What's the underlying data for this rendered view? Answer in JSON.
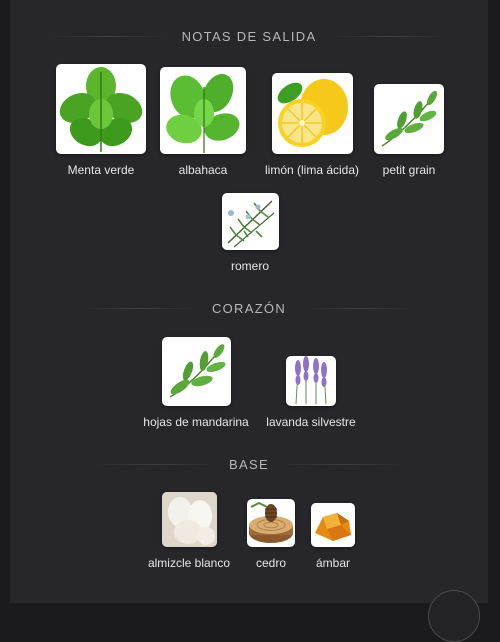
{
  "sections": {
    "top": {
      "title": "NOTAS DE SALIDA",
      "notes": [
        {
          "label": "Menta verde",
          "icon": "mint-leaves-icon"
        },
        {
          "label": "albahaca",
          "icon": "basil-leaves-icon"
        },
        {
          "label": "limón (lima ácida)",
          "icon": "lemon-icon"
        },
        {
          "label": "petit grain",
          "icon": "petitgrain-branch-icon"
        },
        {
          "label": "romero",
          "icon": "rosemary-icon"
        }
      ]
    },
    "heart": {
      "title": "CORAZÓN",
      "notes": [
        {
          "label": "hojas de mandarina",
          "icon": "mandarin-leaves-icon"
        },
        {
          "label": "lavanda silvestre",
          "icon": "lavender-icon"
        }
      ]
    },
    "base": {
      "title": "BASE",
      "notes": [
        {
          "label": "almizcle blanco",
          "icon": "white-musk-icon"
        },
        {
          "label": "cedro",
          "icon": "cedar-wood-icon"
        },
        {
          "label": "ámbar",
          "icon": "amber-icon"
        }
      ]
    }
  }
}
